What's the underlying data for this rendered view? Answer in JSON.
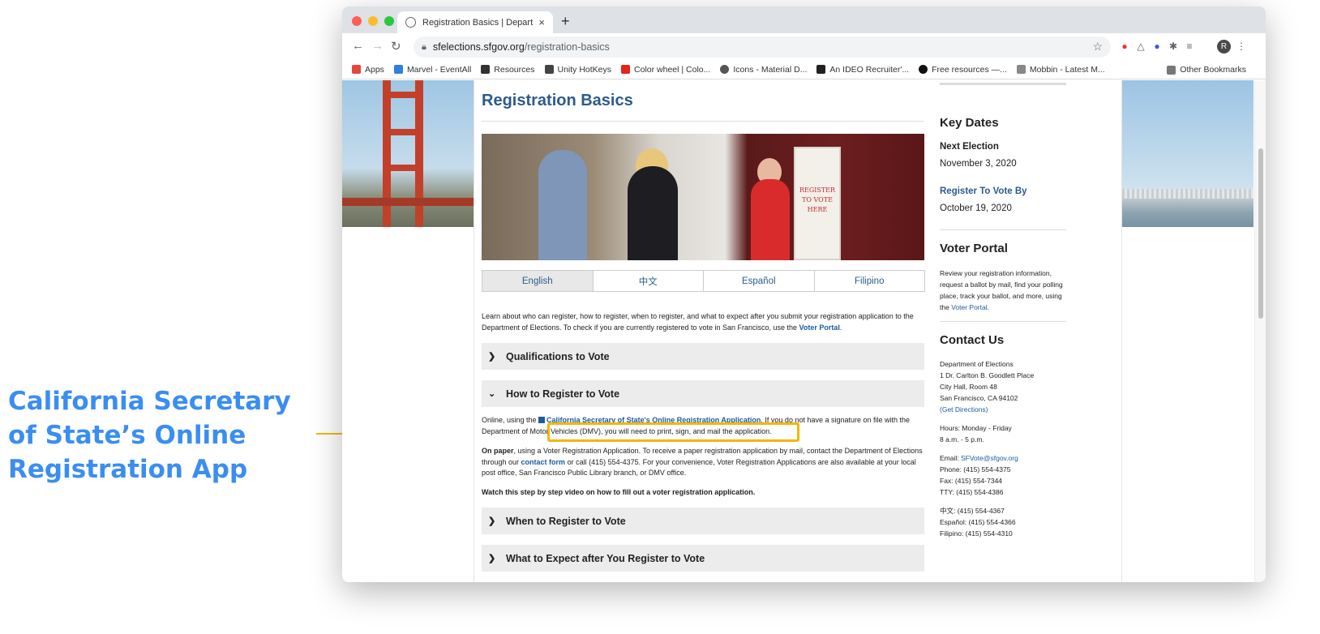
{
  "callout": {
    "text": "California Secretary of State’s Online Registration App"
  },
  "browser": {
    "tab_title": "Registration Basics | Departme",
    "url_host": "sfelections.sfgov.org",
    "url_path": "/registration-basics",
    "avatar_letter": "R",
    "bookmarks": [
      {
        "label": "Apps",
        "icon": "apps-grid-icon",
        "color": "#e8453c"
      },
      {
        "label": "Marvel - EventAll",
        "icon": "marvel-icon",
        "color": "#2f7fe0"
      },
      {
        "label": "Resources",
        "icon": "notion-icon",
        "color": "#333333"
      },
      {
        "label": "Unity HotKeys",
        "icon": "unity-icon",
        "color": "#444444"
      },
      {
        "label": "Color wheel | Colo...",
        "icon": "adobe-icon",
        "color": "#e3241b"
      },
      {
        "label": "Icons - Material D...",
        "icon": "material-icon",
        "color": "#555555"
      },
      {
        "label": "An IDEO Recruiter'...",
        "icon": "ideo-icon",
        "color": "#222222"
      },
      {
        "label": "Free resources —...",
        "icon": "circle-icon",
        "color": "#111111"
      },
      {
        "label": "Mobbin - Latest M...",
        "icon": "mobbin-icon",
        "color": "#888888"
      }
    ],
    "other_bookmarks": "Other Bookmarks"
  },
  "main": {
    "title": "Registration Basics",
    "hero_sign": "REGISTER TO VOTE HERE",
    "languages": [
      "English",
      "中文",
      "Español",
      "Filipino"
    ],
    "intro_text": "Learn about who can register, how to register, when to register, and what to expect after you submit your registration application to the Department of Elections. To check if you are currently registered to vote in San Francisco, use the ",
    "intro_link": "Voter Portal",
    "intro_end": ".",
    "accordions": [
      "Qualifications to Vote",
      "How to Register to Vote",
      "When to Register to Vote",
      "What to Expect after You Register to Vote"
    ],
    "online": {
      "prefix": "Online, using the ",
      "link": "California Secretary of State's Online Registration Application",
      "suffix": ". If you do not have a signature on file with the Department of Motor Vehicles (DMV), you will need to print, sign, and mail the application."
    },
    "paper": {
      "bold": "On paper",
      "text1": ", using a Voter Registration Application. To receive a paper registration application by mail, contact the Department of Elections through our ",
      "link": "contact form",
      "text2": " or call (415) 554-4375. For your convenience, Voter Registration Applications are also available at your local post office, San Francisco Public Library branch, or DMV office."
    },
    "video_link": "Watch this step by step video on how to fill out a voter registration application."
  },
  "sidebar": {
    "key_dates": "Key Dates",
    "next_election_label": "Next Election",
    "next_election_date": "November 3, 2020",
    "register_by_label": "Register To Vote By",
    "register_by_date": "October 19, 2020",
    "voter_portal_title": "Voter Portal",
    "voter_portal_text": "Review your registration information, request a ballot by mail, find your polling place, track your ballot, and more, using the ",
    "voter_portal_link": "Voter Portal",
    "voter_portal_end": ".",
    "contact_title": "Contact Us",
    "address": [
      "Department of Elections",
      "1 Dr. Carlton B. Goodlett Place",
      "City Hall, Room 48",
      "San Francisco, CA 94102"
    ],
    "directions_link": "(Get Directions)",
    "hours": [
      "Hours: Monday - Friday",
      "8 a.m. - 5 p.m."
    ],
    "email_label": "Email: ",
    "email_link": "SFVote@sfgov.org",
    "phones": [
      "Phone: (415) 554-4375",
      "Fax: (415) 554-7344",
      "TTY: (415) 554-4386"
    ],
    "lang_phones": [
      "中文: (415) 554-4367",
      "Español: (415) 554-4366",
      "Filipino: (415) 554-4310"
    ]
  }
}
